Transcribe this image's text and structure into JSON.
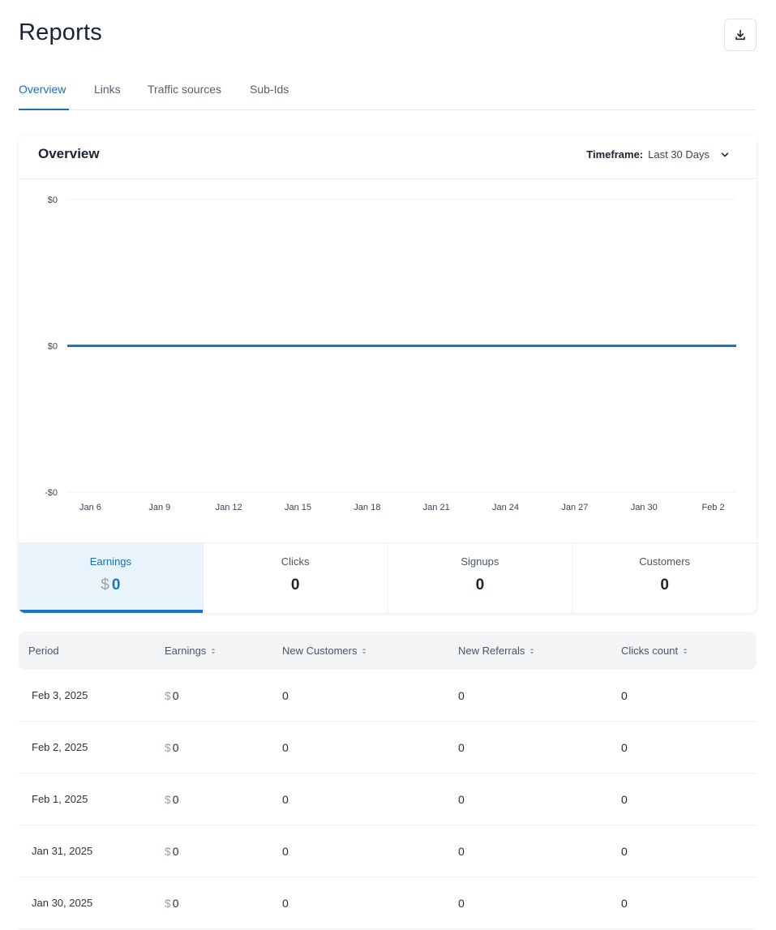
{
  "page": {
    "title": "Reports"
  },
  "tabs": [
    {
      "label": "Overview",
      "active": true
    },
    {
      "label": "Links",
      "active": false
    },
    {
      "label": "Traffic sources",
      "active": false
    },
    {
      "label": "Sub-Ids",
      "active": false
    }
  ],
  "overview": {
    "title": "Overview",
    "timeframe_label": "Timeframe:",
    "timeframe_value": "Last 30 Days"
  },
  "chart_data": {
    "type": "line",
    "title": "",
    "xlabel": "",
    "ylabel": "",
    "y_tick_labels": [
      "$0",
      "$0",
      "-$0"
    ],
    "x_tick_labels": [
      "Jan 6",
      "Jan 9",
      "Jan 12",
      "Jan 15",
      "Jan 18",
      "Jan 21",
      "Jan 24",
      "Jan 27",
      "Jan 30",
      "Feb 2"
    ],
    "x": [
      "Jan 5",
      "Jan 6",
      "Jan 7",
      "Jan 8",
      "Jan 9",
      "Jan 10",
      "Jan 11",
      "Jan 12",
      "Jan 13",
      "Jan 14",
      "Jan 15",
      "Jan 16",
      "Jan 17",
      "Jan 18",
      "Jan 19",
      "Jan 20",
      "Jan 21",
      "Jan 22",
      "Jan 23",
      "Jan 24",
      "Jan 25",
      "Jan 26",
      "Jan 27",
      "Jan 28",
      "Jan 29",
      "Jan 30",
      "Jan 31",
      "Feb 1",
      "Feb 2",
      "Feb 3"
    ],
    "series": [
      {
        "values": [
          0,
          0,
          0,
          0,
          0,
          0,
          0,
          0,
          0,
          0,
          0,
          0,
          0,
          0,
          0,
          0,
          0,
          0,
          0,
          0,
          0,
          0,
          0,
          0,
          0,
          0,
          0,
          0,
          0,
          0
        ]
      }
    ],
    "ylim": [
      -1,
      1
    ],
    "grid": true,
    "color": "#1a73c6"
  },
  "stats": [
    {
      "label": "Earnings",
      "currency": "$",
      "value": "0",
      "active": true
    },
    {
      "label": "Clicks",
      "currency": "",
      "value": "0",
      "active": false
    },
    {
      "label": "Signups",
      "currency": "",
      "value": "0",
      "active": false
    },
    {
      "label": "Customers",
      "currency": "",
      "value": "0",
      "active": false
    }
  ],
  "table": {
    "columns": [
      {
        "label": "Period",
        "sortable": false
      },
      {
        "label": "Earnings",
        "sortable": true
      },
      {
        "label": "New Customers",
        "sortable": true
      },
      {
        "label": "New Referrals",
        "sortable": true
      },
      {
        "label": "Clicks count",
        "sortable": true
      }
    ],
    "currency": "$",
    "rows": [
      {
        "period": "Feb 3, 2025",
        "earnings": "0",
        "new_customers": "0",
        "new_referrals": "0",
        "clicks": "0"
      },
      {
        "period": "Feb 2, 2025",
        "earnings": "0",
        "new_customers": "0",
        "new_referrals": "0",
        "clicks": "0"
      },
      {
        "period": "Feb 1, 2025",
        "earnings": "0",
        "new_customers": "0",
        "new_referrals": "0",
        "clicks": "0"
      },
      {
        "period": "Jan 31, 2025",
        "earnings": "0",
        "new_customers": "0",
        "new_referrals": "0",
        "clicks": "0"
      },
      {
        "period": "Jan 30, 2025",
        "earnings": "0",
        "new_customers": "0",
        "new_referrals": "0",
        "clicks": "0"
      }
    ]
  },
  "colors": {
    "accent": "#1a73c6",
    "active_bg": "#e8f3fc",
    "muted": "#9aa3ad"
  },
  "icons": {
    "download": "download-icon",
    "timeframe": "chevron-down-icon",
    "sort": "sort-icon"
  }
}
